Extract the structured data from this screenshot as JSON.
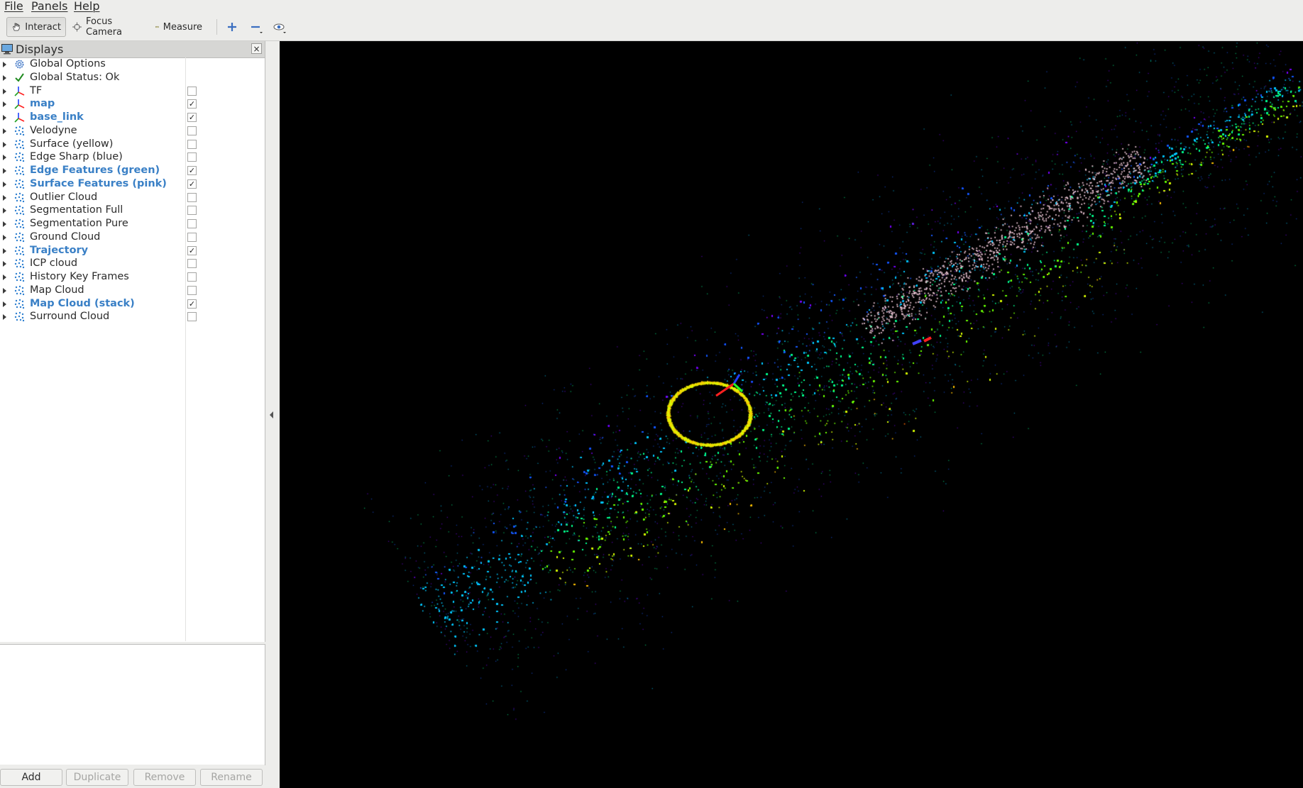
{
  "menu": [
    "File",
    "Panels",
    "Help"
  ],
  "toolbar": {
    "interact_label": "Interact",
    "focus_camera_label": "Focus Camera",
    "measure_label": "Measure",
    "icons": [
      "hand-icon",
      "crosshair-icon",
      "ruler-icon",
      "plus-icon",
      "minus-icon",
      "eye-icon"
    ]
  },
  "displays": {
    "title": "Displays",
    "close_symbol": "×",
    "rows": [
      {
        "label": "Global Options",
        "icon": "gear-icon",
        "checkbox": null,
        "highlight": false
      },
      {
        "label": "Global Status: Ok",
        "icon": "checkmark-icon",
        "checkbox": null,
        "highlight": false
      },
      {
        "label": "TF",
        "icon": "axes-icon",
        "checkbox": false,
        "highlight": false
      },
      {
        "label": "map",
        "icon": "axes-icon",
        "checkbox": true,
        "highlight": true
      },
      {
        "label": "base_link",
        "icon": "axes-icon",
        "checkbox": true,
        "highlight": true
      },
      {
        "label": "Velodyne",
        "icon": "pointcloud-icon",
        "checkbox": false,
        "highlight": false
      },
      {
        "label": "Surface (yellow)",
        "icon": "pointcloud-icon",
        "checkbox": false,
        "highlight": false
      },
      {
        "label": "Edge Sharp (blue)",
        "icon": "pointcloud-icon",
        "checkbox": false,
        "highlight": false
      },
      {
        "label": "Edge Features (green)",
        "icon": "pointcloud-icon",
        "checkbox": true,
        "highlight": true
      },
      {
        "label": "Surface Features (pink)",
        "icon": "pointcloud-icon",
        "checkbox": true,
        "highlight": true
      },
      {
        "label": "Outlier Cloud",
        "icon": "pointcloud-icon",
        "checkbox": false,
        "highlight": false
      },
      {
        "label": "Segmentation Full",
        "icon": "pointcloud-icon",
        "checkbox": false,
        "highlight": false
      },
      {
        "label": "Segmentation Pure",
        "icon": "pointcloud-icon",
        "checkbox": false,
        "highlight": false
      },
      {
        "label": "Ground Cloud",
        "icon": "pointcloud-icon",
        "checkbox": false,
        "highlight": false
      },
      {
        "label": "Trajectory",
        "icon": "pointcloud-icon",
        "checkbox": true,
        "highlight": true
      },
      {
        "label": "ICP cloud",
        "icon": "pointcloud-icon",
        "checkbox": false,
        "highlight": false
      },
      {
        "label": "History Key Frames",
        "icon": "pointcloud-icon",
        "checkbox": false,
        "highlight": false
      },
      {
        "label": "Map Cloud",
        "icon": "pointcloud-icon",
        "checkbox": false,
        "highlight": false
      },
      {
        "label": "Map Cloud (stack)",
        "icon": "pointcloud-icon",
        "checkbox": true,
        "highlight": true
      },
      {
        "label": "Surround Cloud",
        "icon": "pointcloud-icon",
        "checkbox": false,
        "highlight": false
      }
    ],
    "check_symbol": "✓"
  },
  "buttons": [
    {
      "label": "Add",
      "enabled": true
    },
    {
      "label": "Duplicate",
      "enabled": false
    },
    {
      "label": "Remove",
      "enabled": false
    },
    {
      "label": "Rename",
      "enabled": false
    }
  ],
  "colors": {
    "highlight_text": "#3a80c6",
    "viewport_bg": "#000000",
    "cloud_gradient": [
      "#7a00ff",
      "#1a5cff",
      "#00c8ff",
      "#00ff90",
      "#6cff00",
      "#d8ff00",
      "#ffc000",
      "#ff6a00"
    ]
  }
}
